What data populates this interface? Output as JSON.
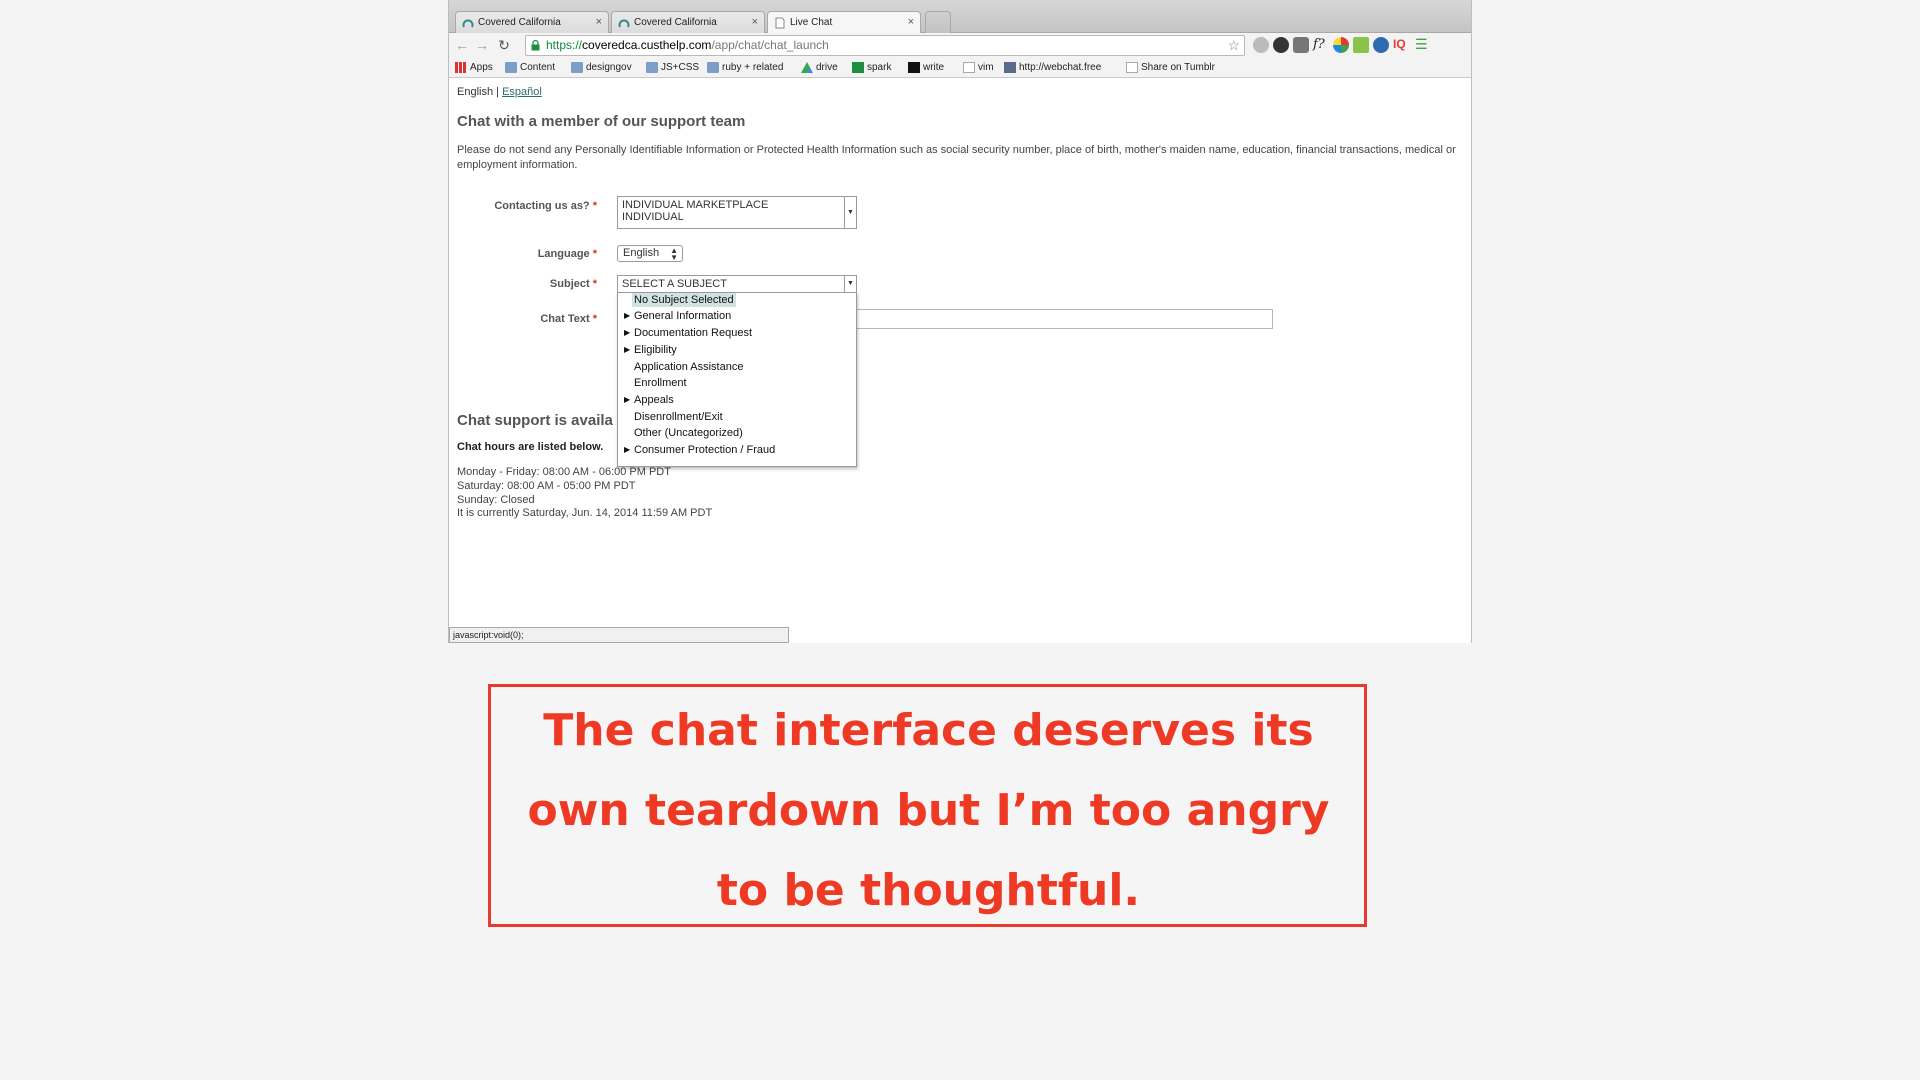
{
  "browser": {
    "tabs": [
      {
        "title": "Covered California"
      },
      {
        "title": "Covered California"
      },
      {
        "title": "Live Chat"
      }
    ],
    "tab_close_glyph": "×",
    "url": {
      "scheme": "https://",
      "host": "coveredca.custhelp.com",
      "path": "/app/chat/chat_launch"
    },
    "bookmarks": [
      "Apps",
      "Content",
      "designgov",
      "JS+CSS",
      "ruby + related",
      "drive",
      "spark",
      "write",
      "vim",
      "http://webchat.free",
      "Share on Tumblr"
    ],
    "status_text": "javascript:void(0);"
  },
  "page": {
    "lang": {
      "current": "English",
      "separator": "|",
      "other": "Español"
    },
    "title": "Chat with a member of our support team",
    "privacy_note": "Please do not send any Personally Identifiable Information or Protected Health Information such as social security number, place of birth, mother's maiden name, education, financial transactions, medical or employment information.",
    "form": {
      "contact_label": "Contacting us as?",
      "contact_value_line1": "INDIVIDUAL MARKETPLACE",
      "contact_value_line2": "INDIVIDUAL",
      "language_label": "Language",
      "language_value": "English",
      "subject_label": "Subject",
      "subject_value": "SELECT A SUBJECT",
      "chat_text_label": "Chat Text",
      "required_mark": "*"
    },
    "subject_options": [
      {
        "label": "No Subject Selected",
        "expandable": false,
        "selected": true
      },
      {
        "label": "General Information",
        "expandable": true,
        "selected": false
      },
      {
        "label": "Documentation Request",
        "expandable": true,
        "selected": false
      },
      {
        "label": "Eligibility",
        "expandable": true,
        "selected": false
      },
      {
        "label": "Application Assistance",
        "expandable": false,
        "selected": false
      },
      {
        "label": "Enrollment",
        "expandable": false,
        "selected": false
      },
      {
        "label": "Appeals",
        "expandable": true,
        "selected": false
      },
      {
        "label": "Disenrollment/Exit",
        "expandable": false,
        "selected": false
      },
      {
        "label": "Other (Uncategorized)",
        "expandable": false,
        "selected": false
      },
      {
        "label": "Consumer Protection / Fraud",
        "expandable": true,
        "selected": false
      }
    ],
    "support": {
      "title": "Chat support is availa",
      "hours_intro": "Chat hours are listed below.",
      "hours": [
        "Monday - Friday:  08:00 AM - 06:00 PM PDT",
        "Saturday:  08:00 AM - 05:00 PM PDT",
        "Sunday:  Closed",
        "It is currently Saturday, Jun. 14, 2014 11:59 AM PDT"
      ]
    }
  },
  "annotation": {
    "text": "The chat interface deserves its own teardown but I’m too angry to be thoughtful.",
    "color": "#ee3a24"
  },
  "colors": {
    "link": "#2a6f6d",
    "required": "#c0392b",
    "secure_scheme": "#138a3a",
    "selected_option_bg": "#cfe3e2"
  }
}
